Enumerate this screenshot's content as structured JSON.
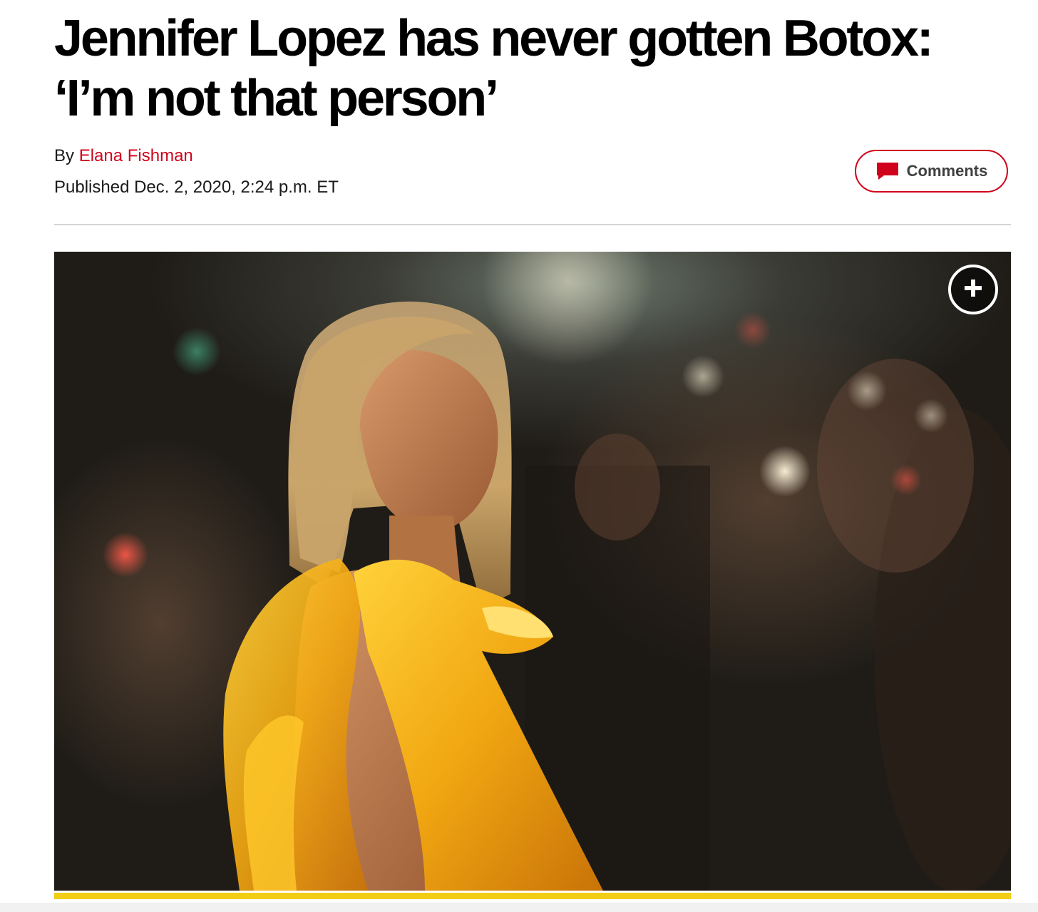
{
  "article": {
    "headline_line1": "Jennifer Lopez has never gotten Botox:",
    "headline_line2": "‘I’m not that person’",
    "byline_prefix": "By",
    "author": "Elana Fishman",
    "published": "Published Dec. 2, 2020, 2:24 p.m. ET"
  },
  "actions": {
    "comments_label": "Comments",
    "comments_icon": "speech-bubble-icon",
    "expand_icon": "plus-icon"
  },
  "colors": {
    "brand_red": "#d0021b",
    "accent_yellow": "#f2cd15",
    "divider": "#d6d6d6"
  }
}
